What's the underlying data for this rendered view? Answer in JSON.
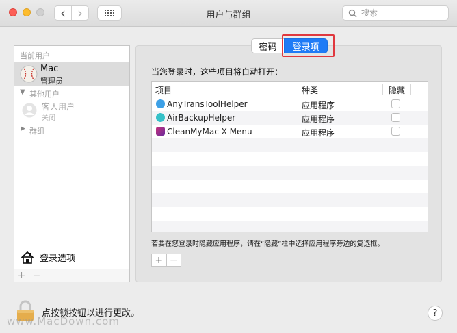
{
  "window": {
    "title": "用户与群组"
  },
  "toolbar": {
    "back_glyph": "‹",
    "forward_glyph": "›",
    "search_placeholder": "搜索"
  },
  "sidebar": {
    "current_users_header": "当前用户",
    "current_user": {
      "name": "Mac",
      "role": "管理员"
    },
    "other_users_header": "其他用户",
    "guest_user": {
      "name": "客人用户",
      "status": "关闭"
    },
    "groups_header": "群组",
    "login_options_label": "登录选项",
    "add_label": "+",
    "remove_label": "−"
  },
  "tabs": {
    "password": "密码",
    "login_items": "登录项"
  },
  "login_items": {
    "heading": "当您登录时，这些项目将自动打开：",
    "columns": [
      "项目",
      "种类",
      "隐藏"
    ],
    "rows": [
      {
        "name": "AnyTransToolHelper",
        "kind": "应用程序",
        "hidden": false,
        "icon": "anytrans-icon"
      },
      {
        "name": "AirBackupHelper",
        "kind": "应用程序",
        "hidden": false,
        "icon": "airbackup-icon"
      },
      {
        "name": "CleanMyMac X Menu",
        "kind": "应用程序",
        "hidden": false,
        "icon": "cleanmymac-icon"
      }
    ],
    "hint": "若要在您登录时隐藏应用程序，请在“隐藏”栏中选择应用程序旁边的复选框。",
    "add_label": "+",
    "remove_label": "−"
  },
  "footer": {
    "lock_text": "点按锁按钮以进行更改。",
    "help_label": "?",
    "watermark": "www.MacDown.com"
  },
  "colors": {
    "accent": "#1f7bf6",
    "highlight_box": "#e0383e",
    "selected_row": "#dcdcdc"
  }
}
